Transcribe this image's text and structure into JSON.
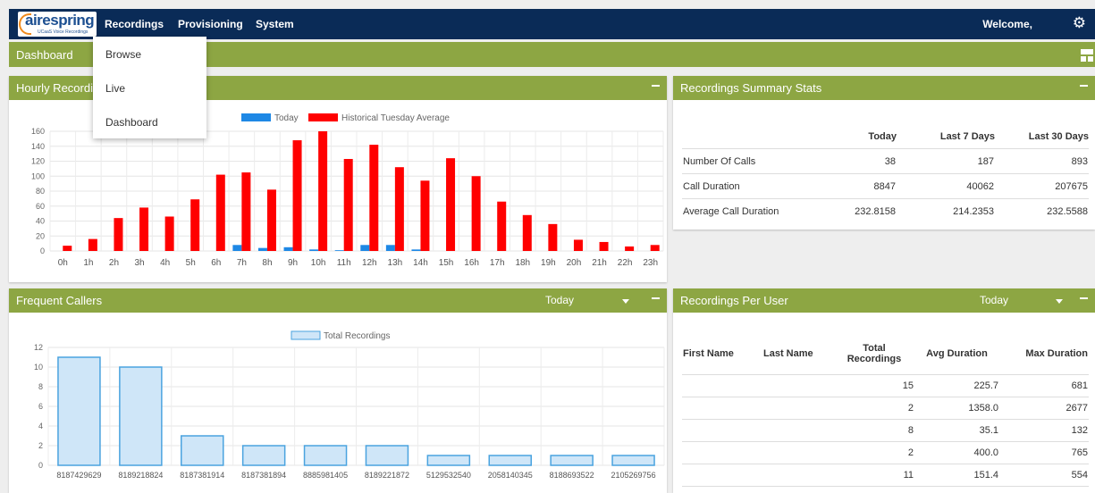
{
  "header": {
    "logo_text": "airespring",
    "logo_subtext": "UCaaS Voice Recordings",
    "nav": [
      "Recordings",
      "Provisioning",
      "System"
    ],
    "welcome": "Welcome,"
  },
  "subbar": {
    "title": "Dashboard"
  },
  "dropdown": {
    "items": [
      "Browse",
      "Live",
      "Dashboard"
    ]
  },
  "panels": {
    "hourly_title": "Hourly Recordings",
    "summary_title": "Recordings Summary Stats",
    "frequent_title": "Frequent Callers",
    "frequent_period": "Today",
    "per_user_title": "Recordings Per User",
    "per_user_period": "Today"
  },
  "summary": {
    "headers": [
      "Today",
      "Last 7 Days",
      "Last 30 Days"
    ],
    "rows": [
      {
        "label": "Number Of Calls",
        "today": "38",
        "last7": "187",
        "last30": "893"
      },
      {
        "label": "Call Duration",
        "today": "8847",
        "last7": "40062",
        "last30": "207675"
      },
      {
        "label": "Average Call Duration",
        "today": "232.8158",
        "last7": "214.2353",
        "last30": "232.5588"
      }
    ]
  },
  "per_user": {
    "headers": [
      "First Name",
      "Last Name",
      "Total Recordings",
      "Avg Duration",
      "Max Duration"
    ],
    "rows": [
      {
        "first": "",
        "last": "",
        "total": "15",
        "avg": "225.7",
        "max": "681"
      },
      {
        "first": "",
        "last": "",
        "total": "2",
        "avg": "1358.0",
        "max": "2677"
      },
      {
        "first": "",
        "last": "",
        "total": "8",
        "avg": "35.1",
        "max": "132"
      },
      {
        "first": "",
        "last": "",
        "total": "2",
        "avg": "400.0",
        "max": "765"
      },
      {
        "first": "",
        "last": "",
        "total": "11",
        "avg": "151.4",
        "max": "554"
      }
    ]
  },
  "chart_data": [
    {
      "type": "bar",
      "categories": [
        "0h",
        "1h",
        "2h",
        "3h",
        "4h",
        "5h",
        "6h",
        "7h",
        "8h",
        "9h",
        "10h",
        "11h",
        "12h",
        "13h",
        "14h",
        "15h",
        "16h",
        "17h",
        "18h",
        "19h",
        "20h",
        "21h",
        "22h",
        "23h"
      ],
      "series": [
        {
          "name": "Today",
          "color": "#1e88e5",
          "values": [
            0,
            0,
            0,
            0,
            0,
            0,
            0,
            8,
            4,
            5,
            2,
            1,
            8,
            8,
            2,
            0,
            0,
            0,
            0,
            0,
            0,
            0,
            0,
            0
          ]
        },
        {
          "name": "Historical Tuesday Average",
          "color": "#ff0000",
          "values": [
            7,
            16,
            44,
            58,
            46,
            69,
            102,
            105,
            82,
            148,
            160,
            123,
            142,
            112,
            94,
            124,
            100,
            66,
            48,
            36,
            15,
            12,
            6,
            8
          ]
        }
      ],
      "ylim": [
        0,
        160
      ],
      "yticks": [
        0,
        20,
        40,
        60,
        80,
        100,
        120,
        140,
        160
      ],
      "legend": "top-center"
    },
    {
      "type": "bar",
      "categories": [
        "8187429629",
        "8189218824",
        "8187381914",
        "8187381894",
        "8885981405",
        "8189221872",
        "5129532540",
        "2058140345",
        "8188693522",
        "2105269756"
      ],
      "series": [
        {
          "name": "Total Recordings",
          "color": "#cfe6f8",
          "values": [
            11,
            10,
            3,
            2,
            2,
            2,
            1,
            1,
            1,
            1
          ]
        }
      ],
      "ylim": [
        0,
        12
      ],
      "yticks": [
        0,
        2,
        4,
        6,
        8,
        10,
        12
      ],
      "legend": "top-center"
    }
  ]
}
